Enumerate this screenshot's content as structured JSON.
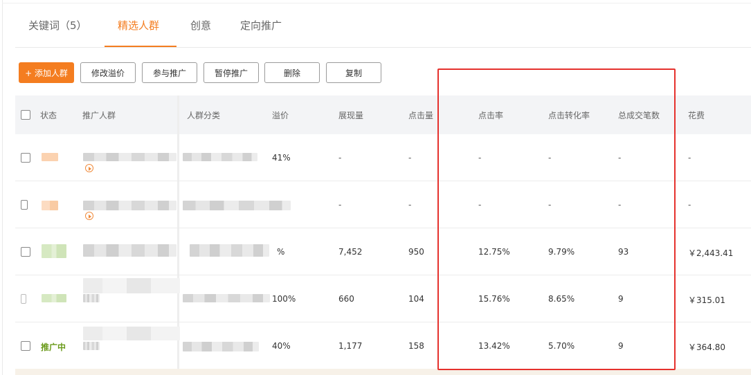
{
  "tabs": [
    {
      "label": "关键词（5）"
    },
    {
      "label": "精选人群"
    },
    {
      "label": "创意"
    },
    {
      "label": "定向推广"
    }
  ],
  "active_tab": "精选人群",
  "toolbar": {
    "add_label": "+ 添加人群",
    "modify_label": "修改溢价",
    "join_label": "参与推广",
    "pause_label": "暂停推广",
    "delete_label": "删除",
    "copy_label": "复制"
  },
  "columns": [
    "状态",
    "推广人群",
    "人群分类",
    "溢价",
    "展现量",
    "点击量",
    "点击率",
    "点击转化率",
    "总成交笔数",
    "花费"
  ],
  "rows": [
    {
      "status": "",
      "premium": "41%",
      "impressions": "-",
      "clicks": "-",
      "ctr": "-",
      "cvr": "-",
      "orders": "-",
      "cost": "-"
    },
    {
      "status": "",
      "premium": "",
      "impressions": "-",
      "clicks": "-",
      "ctr": "-",
      "cvr": "-",
      "orders": "-",
      "cost": "-"
    },
    {
      "status": "",
      "premium": "%",
      "impressions": "7,452",
      "clicks": "950",
      "ctr": "12.75%",
      "cvr": "9.79%",
      "orders": "93",
      "cost": "￥2,443.41"
    },
    {
      "status": "",
      "premium": "100%",
      "impressions": "660",
      "clicks": "104",
      "ctr": "15.76%",
      "cvr": "8.65%",
      "orders": "9",
      "cost": "￥315.01"
    },
    {
      "status": "推广中",
      "premium": "40%",
      "impressions": "1,177",
      "clicks": "158",
      "ctr": "13.42%",
      "cvr": "5.70%",
      "orders": "9",
      "cost": "￥364.80"
    }
  ],
  "colors": {
    "accent": "#f47d20",
    "highlight": "#e5302c",
    "running": "#6a9a1a"
  }
}
